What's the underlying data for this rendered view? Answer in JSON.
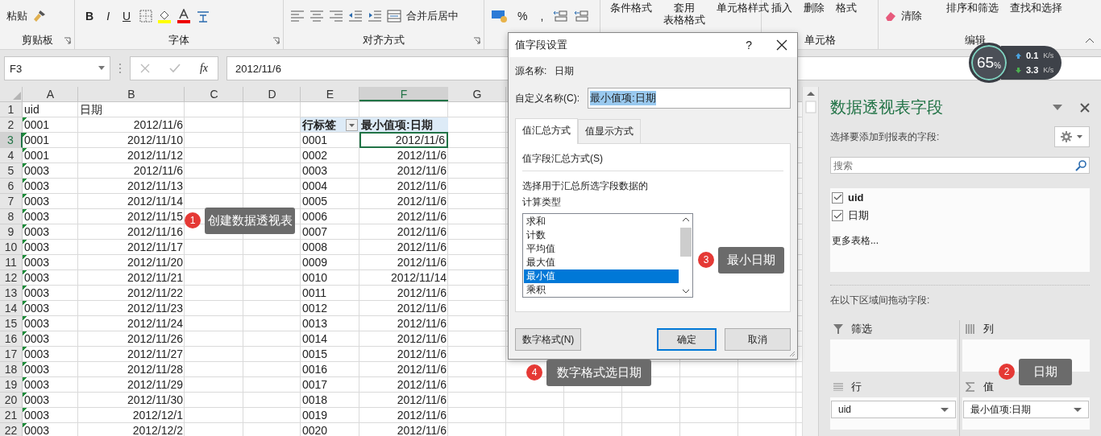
{
  "ribbon": {
    "groups": [
      {
        "label": "剪贴板",
        "items": [
          {
            "kind": "big",
            "label": "粘贴"
          }
        ]
      },
      {
        "label": "字体",
        "items": [
          {
            "kind": "char",
            "label": "B"
          },
          {
            "kind": "char",
            "label": "I"
          },
          {
            "kind": "char",
            "label": "U"
          }
        ]
      },
      {
        "label": "对齐方式",
        "items": [
          {
            "kind": "text",
            "label": "合并后居中"
          }
        ]
      },
      {
        "items": [
          {
            "kind": "char",
            "label": "%"
          },
          {
            "kind": "char",
            "label": ","
          }
        ]
      },
      {
        "items": [
          {
            "kind": "stack",
            "label": "条件格式"
          },
          {
            "kind": "stack",
            "label": "套用",
            "label2": "表格格式"
          },
          {
            "kind": "stack",
            "label": "单元格样式"
          }
        ]
      },
      {
        "label": "单元格",
        "items": [
          {
            "kind": "stack",
            "label": "插入"
          },
          {
            "kind": "stack",
            "label": "删除"
          },
          {
            "kind": "stack",
            "label": "格式"
          }
        ]
      },
      {
        "label": "编辑",
        "items": [
          {
            "kind": "small",
            "label": "清除"
          },
          {
            "kind": "stack",
            "label": "排序和筛选"
          },
          {
            "kind": "stack",
            "label": "查找和选择"
          }
        ]
      }
    ]
  },
  "formula_bar": {
    "name_box": "F3",
    "fx": "fx",
    "value": "2012/11/6"
  },
  "sheet": {
    "columns": [
      {
        "label": "A",
        "selected": false
      },
      {
        "label": "B",
        "selected": false
      },
      {
        "label": "C",
        "selected": false
      },
      {
        "label": "D",
        "selected": false
      },
      {
        "label": "E",
        "selected": false
      },
      {
        "label": "F",
        "selected": true
      },
      {
        "label": "G",
        "selected": false
      }
    ],
    "rows": [
      {
        "num": "1",
        "kind": "header",
        "selected": false,
        "flag": false,
        "a": "uid",
        "b": "日期"
      },
      {
        "num": "2",
        "kind": "pivot-header",
        "selected": false,
        "flag": true,
        "a": "0001",
        "b": "2012/11/6",
        "e": "行标签",
        "f": "最小值项:日期"
      },
      {
        "num": "3",
        "kind": "data",
        "selected": true,
        "flag": true,
        "a": "0001",
        "b": "2012/11/10",
        "e": "0001",
        "f": "2012/11/6"
      },
      {
        "num": "4",
        "kind": "data",
        "selected": false,
        "flag": true,
        "a": "0001",
        "b": "2012/11/12",
        "e": "0002",
        "f": "2012/11/6"
      },
      {
        "num": "5",
        "kind": "data",
        "selected": false,
        "flag": true,
        "a": "0003",
        "b": "2012/11/6",
        "e": "0003",
        "f": "2012/11/6"
      },
      {
        "num": "6",
        "kind": "data",
        "selected": false,
        "flag": true,
        "a": "0003",
        "b": "2012/11/13",
        "e": "0004",
        "f": "2012/11/6"
      },
      {
        "num": "7",
        "kind": "data",
        "selected": false,
        "flag": true,
        "a": "0003",
        "b": "2012/11/14",
        "e": "0005",
        "f": "2012/11/6"
      },
      {
        "num": "8",
        "kind": "data",
        "selected": false,
        "flag": true,
        "a": "0003",
        "b": "2012/11/15",
        "e": "0006",
        "f": "2012/11/6"
      },
      {
        "num": "9",
        "kind": "data",
        "selected": false,
        "flag": true,
        "a": "0003",
        "b": "2012/11/16",
        "e": "0007",
        "f": "2012/11/6"
      },
      {
        "num": "10",
        "kind": "data",
        "selected": false,
        "flag": true,
        "a": "0003",
        "b": "2012/11/17",
        "e": "0008",
        "f": "2012/11/6"
      },
      {
        "num": "11",
        "kind": "data",
        "selected": false,
        "flag": true,
        "a": "0003",
        "b": "2012/11/20",
        "e": "0009",
        "f": "2012/11/6"
      },
      {
        "num": "12",
        "kind": "data",
        "selected": false,
        "flag": true,
        "a": "0003",
        "b": "2012/11/21",
        "e": "0010",
        "f": "2012/11/14"
      },
      {
        "num": "13",
        "kind": "data",
        "selected": false,
        "flag": true,
        "a": "0003",
        "b": "2012/11/22",
        "e": "0011",
        "f": "2012/11/6"
      },
      {
        "num": "14",
        "kind": "data",
        "selected": false,
        "flag": true,
        "a": "0003",
        "b": "2012/11/23",
        "e": "0012",
        "f": "2012/11/6"
      },
      {
        "num": "15",
        "kind": "data",
        "selected": false,
        "flag": true,
        "a": "0003",
        "b": "2012/11/24",
        "e": "0013",
        "f": "2012/11/6"
      },
      {
        "num": "16",
        "kind": "data",
        "selected": false,
        "flag": true,
        "a": "0003",
        "b": "2012/11/26",
        "e": "0014",
        "f": "2012/11/6"
      },
      {
        "num": "17",
        "kind": "data",
        "selected": false,
        "flag": true,
        "a": "0003",
        "b": "2012/11/27",
        "e": "0015",
        "f": "2012/11/6"
      },
      {
        "num": "18",
        "kind": "data",
        "selected": false,
        "flag": true,
        "a": "0003",
        "b": "2012/11/28",
        "e": "0016",
        "f": "2012/11/6"
      },
      {
        "num": "19",
        "kind": "data",
        "selected": false,
        "flag": true,
        "a": "0003",
        "b": "2012/11/29",
        "e": "0017",
        "f": "2012/11/6"
      },
      {
        "num": "20",
        "kind": "data",
        "selected": false,
        "flag": true,
        "a": "0003",
        "b": "2012/11/30",
        "e": "0018",
        "f": "2012/11/6"
      },
      {
        "num": "21",
        "kind": "data",
        "selected": false,
        "flag": true,
        "a": "0003",
        "b": "2012/12/1",
        "e": "0019",
        "f": "2012/11/6"
      },
      {
        "num": "22",
        "kind": "data",
        "selected": false,
        "flag": true,
        "a": "0003",
        "b": "2012/12/2",
        "e": "0020",
        "f": "2012/11/6"
      }
    ]
  },
  "dialog": {
    "title": "值字段设置",
    "help": "?",
    "source_label": "源名称:",
    "source_value": "日期",
    "custom_label": "自定义名称(C):",
    "custom_value": "最小值项:日期",
    "tabs": [
      {
        "label": "值汇总方式",
        "selected": true
      },
      {
        "label": "值显示方式",
        "selected": false
      }
    ],
    "section": "值字段汇总方式(S)",
    "description": [
      "选择用于汇总所选字段数据的",
      "计算类型"
    ],
    "options": [
      {
        "label": "求和",
        "selected": false
      },
      {
        "label": "计数",
        "selected": false
      },
      {
        "label": "平均值",
        "selected": false
      },
      {
        "label": "最大值",
        "selected": false
      },
      {
        "label": "最小值",
        "selected": true
      },
      {
        "label": "乘积",
        "selected": false
      }
    ],
    "buttons": [
      {
        "label": "数字格式(N)",
        "kind": "plain"
      },
      {
        "label": "确定",
        "kind": "default"
      },
      {
        "label": "取消",
        "kind": "plain"
      }
    ]
  },
  "network_widget": {
    "percent": "65",
    "percent_unit": "%",
    "up": "0.1",
    "up_unit": "K/s",
    "down": "3.3",
    "down_unit": "K/s"
  },
  "pivot_pane": {
    "title": "数据透视表字段",
    "prompt": "选择要添加到报表的字段:",
    "search_placeholder": "搜索",
    "fields": [
      {
        "label": "uid",
        "checked": true,
        "bold": true
      },
      {
        "label": "日期",
        "checked": true,
        "bold": false
      }
    ],
    "more": "更多表格...",
    "drag_hint": "在以下区域间拖动字段:",
    "areas": [
      {
        "label": "筛选",
        "kind": "filter"
      },
      {
        "label": "列",
        "kind": "columns"
      },
      {
        "label": "行",
        "kind": "rows",
        "items": [
          "uid"
        ]
      },
      {
        "label": "值",
        "kind": "values",
        "items": [
          "最小值项:日期"
        ]
      }
    ]
  },
  "callouts": [
    {
      "number": "1",
      "text": "创建数据透视表"
    },
    {
      "number": "2",
      "text": "日期"
    },
    {
      "number": "3",
      "text": "最小日期"
    },
    {
      "number": "4",
      "text": "数字格式选日期"
    }
  ]
}
